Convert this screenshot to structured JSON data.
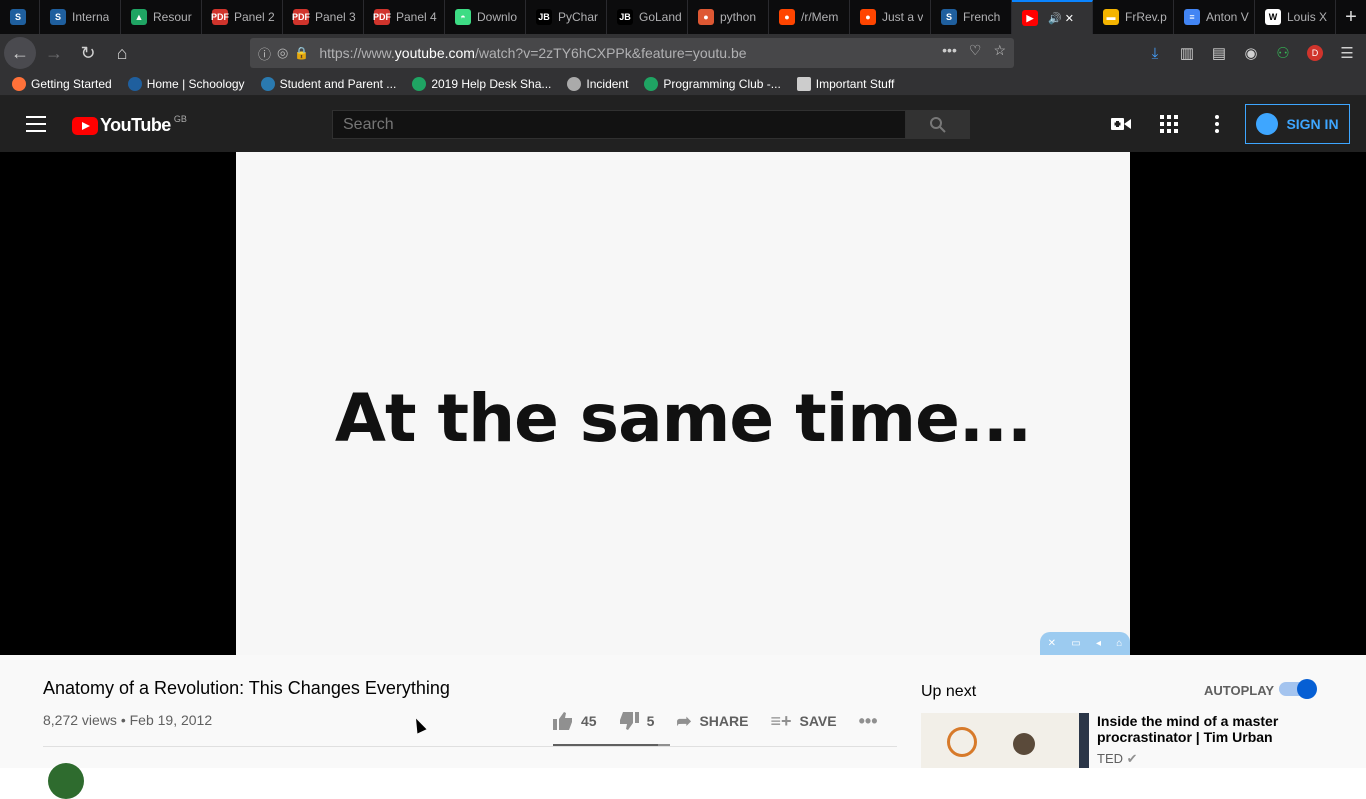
{
  "browser": {
    "tabs": [
      {
        "label": "",
        "icon": "schoology-icon",
        "color": "#1f5f9e",
        "glyph": "S"
      },
      {
        "label": "Interna",
        "icon": "schoology-icon",
        "color": "#1f5f9e",
        "glyph": "S"
      },
      {
        "label": "Resour",
        "icon": "google-drive-icon",
        "color": "#1fa463",
        "glyph": "▲"
      },
      {
        "label": "Panel 2",
        "icon": "pdf-icon",
        "color": "#d0342c",
        "glyph": "PDF"
      },
      {
        "label": "Panel 3",
        "icon": "pdf-icon",
        "color": "#d0342c",
        "glyph": "PDF"
      },
      {
        "label": "Panel 4",
        "icon": "pdf-icon",
        "color": "#d0342c",
        "glyph": "PDF"
      },
      {
        "label": "Downlo",
        "icon": "android-icon",
        "color": "#3ddc84",
        "glyph": "◓"
      },
      {
        "label": "PyChar",
        "icon": "jetbrains-icon",
        "color": "#000000",
        "glyph": "JB"
      },
      {
        "label": "GoLand",
        "icon": "jetbrains-icon",
        "color": "#000000",
        "glyph": "JB"
      },
      {
        "label": "python",
        "icon": "duckduckgo-icon",
        "color": "#de5833",
        "glyph": "●"
      },
      {
        "label": "/r/Mem",
        "icon": "reddit-icon",
        "color": "#ff4500",
        "glyph": "●"
      },
      {
        "label": "Just a v",
        "icon": "reddit-icon",
        "color": "#ff4500",
        "glyph": "●"
      },
      {
        "label": "French",
        "icon": "schoology-icon",
        "color": "#1f5f9e",
        "glyph": "S"
      },
      {
        "label": "",
        "icon": "youtube-icon",
        "color": "#ff0000",
        "glyph": "▶",
        "active": true
      },
      {
        "label": "FrRev.p",
        "icon": "google-slides-icon",
        "color": "#f4b400",
        "glyph": "▬"
      },
      {
        "label": "Anton V",
        "icon": "google-docs-icon",
        "color": "#4285f4",
        "glyph": "≡"
      },
      {
        "label": "Louis X",
        "icon": "wikipedia-icon",
        "color": "#ffffff",
        "glyph": "W"
      }
    ],
    "url_prefix": "https://www.",
    "url_domain": "youtube.com",
    "url_suffix": "/watch?v=2zTY6hCXPPk&feature=youtu.be",
    "bookmarks": [
      {
        "label": "Getting Started",
        "icon": "firefox-icon",
        "color": "#ff7139"
      },
      {
        "label": "Home | Schoology",
        "icon": "schoology-icon",
        "color": "#1f5f9e"
      },
      {
        "label": "Student and Parent ...",
        "icon": "portal-icon",
        "color": "#2a7ab0"
      },
      {
        "label": "2019 Help Desk Sha...",
        "icon": "google-drive-icon",
        "color": "#1fa463"
      },
      {
        "label": "Incident",
        "icon": "globe-icon",
        "color": "#aaaaaa"
      },
      {
        "label": "Programming Club -...",
        "icon": "google-drive-icon",
        "color": "#1fa463"
      },
      {
        "label": "Important Stuff",
        "icon": "folder-icon",
        "color": "#cccccc"
      }
    ]
  },
  "youtube": {
    "logo_text": "YouTube",
    "country": "GB",
    "search_placeholder": "Search",
    "sign_in": "SIGN IN",
    "video_caption": "At the same time...",
    "title": "Anatomy of a Revolution: This Changes Everything",
    "views_date": "8,272 views • Feb 19, 2012",
    "likes": "45",
    "dislikes": "5",
    "like_ratio": 0.9,
    "share": "SHARE",
    "save": "SAVE",
    "up_next": "Up next",
    "autoplay": "AUTOPLAY",
    "autoplay_on": true,
    "recommendation": {
      "title": "Inside the mind of a master procrastinator | Tim Urban",
      "channel": "TED"
    }
  }
}
